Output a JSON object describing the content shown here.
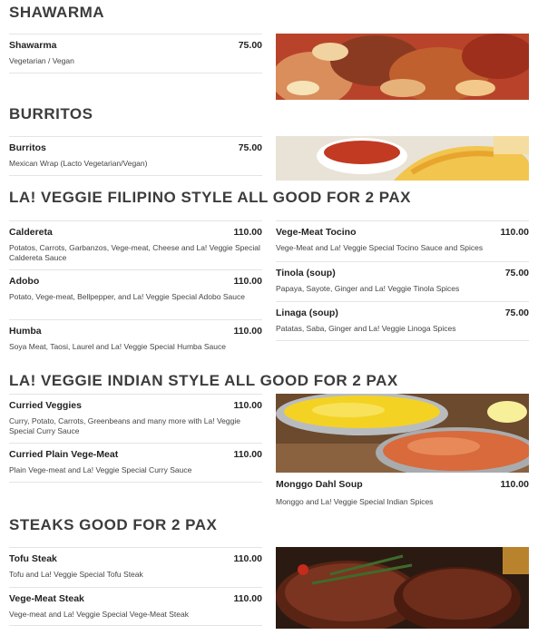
{
  "sections": [
    {
      "heading": "SHAWARMA",
      "items": [
        {
          "name": "Shawarma",
          "price": "75.00",
          "desc": "Vegetarian / Vegan"
        }
      ]
    },
    {
      "heading": "BURRITOS",
      "items": [
        {
          "name": "Burritos",
          "price": "75.00",
          "desc": "Mexican Wrap (Lacto Vegetarian/Vegan)"
        }
      ]
    },
    {
      "heading": "LA! VEGGIE FILIPINO STYLE ALL GOOD FOR 2 PAX",
      "items": [
        {
          "name": "Caldereta",
          "price": "110.00",
          "desc": "Potatos, Carrots, Garbanzos, Vege-meat, Cheese and La! Veggie Special Caldereta Sauce"
        },
        {
          "name": "Adobo",
          "price": "110.00",
          "desc": "Potato, Vege-meat, Bellpepper, and La! Veggie Special Adobo Sauce"
        },
        {
          "name": "Humba",
          "price": "110.00",
          "desc": "Soya Meat, Taosi, Laurel and La! Veggie Special Humba Sauce"
        },
        {
          "name": "Vege-Meat Tocino",
          "price": "110.00",
          "desc": "Vege-Meat and La! Veggie Special Tocino Sauce and Spices"
        },
        {
          "name": "Tinola (soup)",
          "price": "75.00",
          "desc": "Papaya, Sayote, Ginger and La! Veggie Tinola Spices"
        },
        {
          "name": "Linaga (soup)",
          "price": "75.00",
          "desc": "Patatas, Saba, Ginger and La! Veggie Linoga Spices"
        }
      ]
    },
    {
      "heading": "LA! VEGGIE INDIAN STYLE ALL GOOD FOR 2 PAX",
      "items": [
        {
          "name": "Curried Veggies",
          "price": "110.00",
          "desc": "Curry, Potato, Carrots, Greenbeans and many more with La! Veggie Special Curry Sauce"
        },
        {
          "name": "Curried Plain Vege-Meat",
          "price": "110.00",
          "desc": "Plain Vege-meat and La! Veggie Special Curry Sauce"
        },
        {
          "name": "Monggo Dahl Soup",
          "price": "110.00",
          "desc": "Monggo and La! Veggie Special Indian Spices"
        }
      ]
    },
    {
      "heading": "STEAKS GOOD FOR 2 PAX",
      "items": [
        {
          "name": "Tofu Steak",
          "price": "110.00",
          "desc": "Tofu and La! Veggie Special Tofu Steak"
        },
        {
          "name": "Vege-Meat Steak",
          "price": "110.00",
          "desc": "Vege-meat and La! Veggie Special Vege-Meat Steak"
        }
      ]
    }
  ]
}
